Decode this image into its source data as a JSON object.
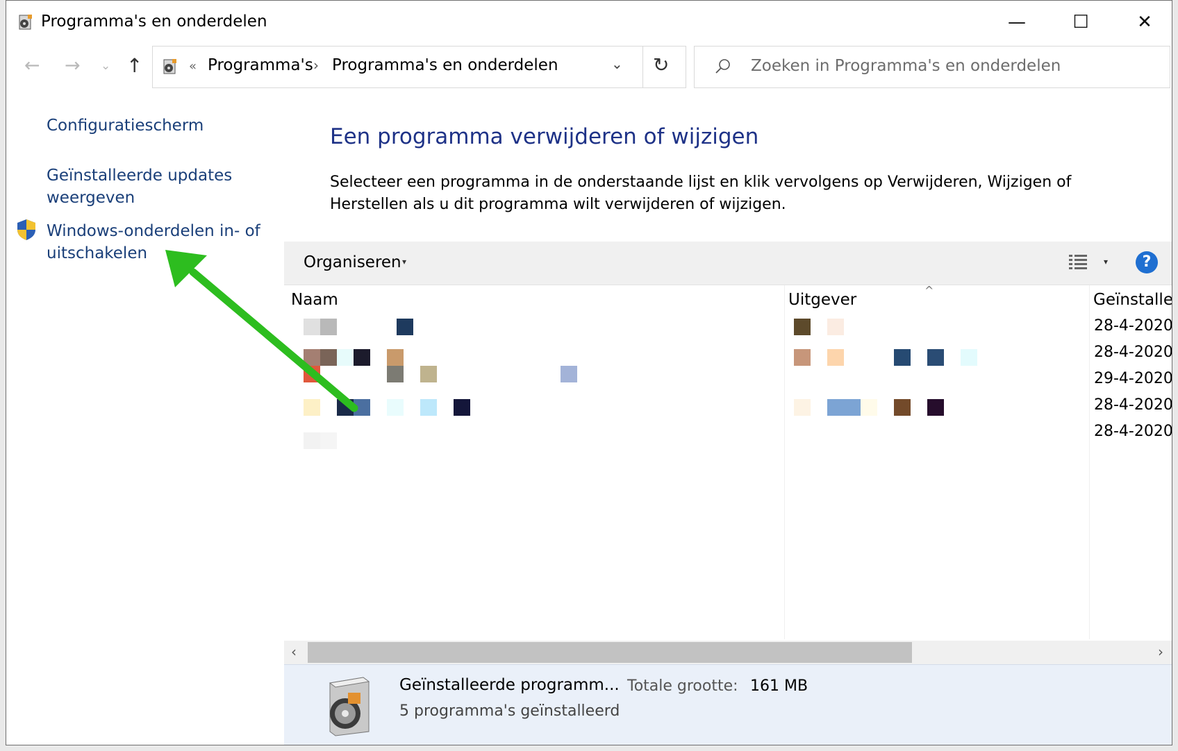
{
  "window": {
    "title": "Programma's en onderdelen",
    "minimize_glyph": "—",
    "maximize_glyph": "☐",
    "close_glyph": "✕"
  },
  "nav": {
    "back_glyph": "←",
    "forward_glyph": "→",
    "recent_glyph": "⌄",
    "up_glyph": "↑"
  },
  "address": {
    "overflow_glyph": "«",
    "breadcrumb": [
      "Programma's",
      "Programma's en onderdelen"
    ],
    "separator_glyph": "›",
    "dropdown_glyph": "⌄",
    "refresh_glyph": "↻"
  },
  "search": {
    "placeholder": "Zoeken in Programma's en onderdelen",
    "icon": "search-icon"
  },
  "sidebar": {
    "links": [
      "Configuratiescherm",
      "Geïnstalleerde updates weergeven",
      "Windows-onderdelen in- of uitschakelen"
    ]
  },
  "main": {
    "heading": "Een programma verwijderen of wijzigen",
    "description": "Selecteer een programma in de onderstaande lijst en klik vervolgens op Verwijderen, Wijzigen of Herstellen als u dit programma wilt verwijderen of wijzigen."
  },
  "toolbar": {
    "organize_label": "Organiseren",
    "caret_glyph": "▾",
    "help_label": "?"
  },
  "list": {
    "columns": [
      "Naam",
      "Uitgever",
      "Geïnstalleerd"
    ],
    "sort_glyph": "^",
    "dates": [
      "28-4-2020",
      "28-4-2020",
      "29-4-2020",
      "28-4-2020",
      "28-4-2020"
    ]
  },
  "scrollbar": {
    "left_glyph": "‹",
    "right_glyph": "›"
  },
  "details": {
    "title": "Geïnstalleerde programm...",
    "size_label": "Totale grootte:",
    "size_value": "161 MB",
    "count": "5 programma's geïnstalleerd"
  },
  "colors": {
    "link": "#1a3f79",
    "heading": "#1e3287",
    "toolbar_bg": "#f0f0f0",
    "details_bg": "#eaf0f9",
    "annotation_arrow": "#2dbd1f",
    "help_button": "#1f6fd1"
  }
}
